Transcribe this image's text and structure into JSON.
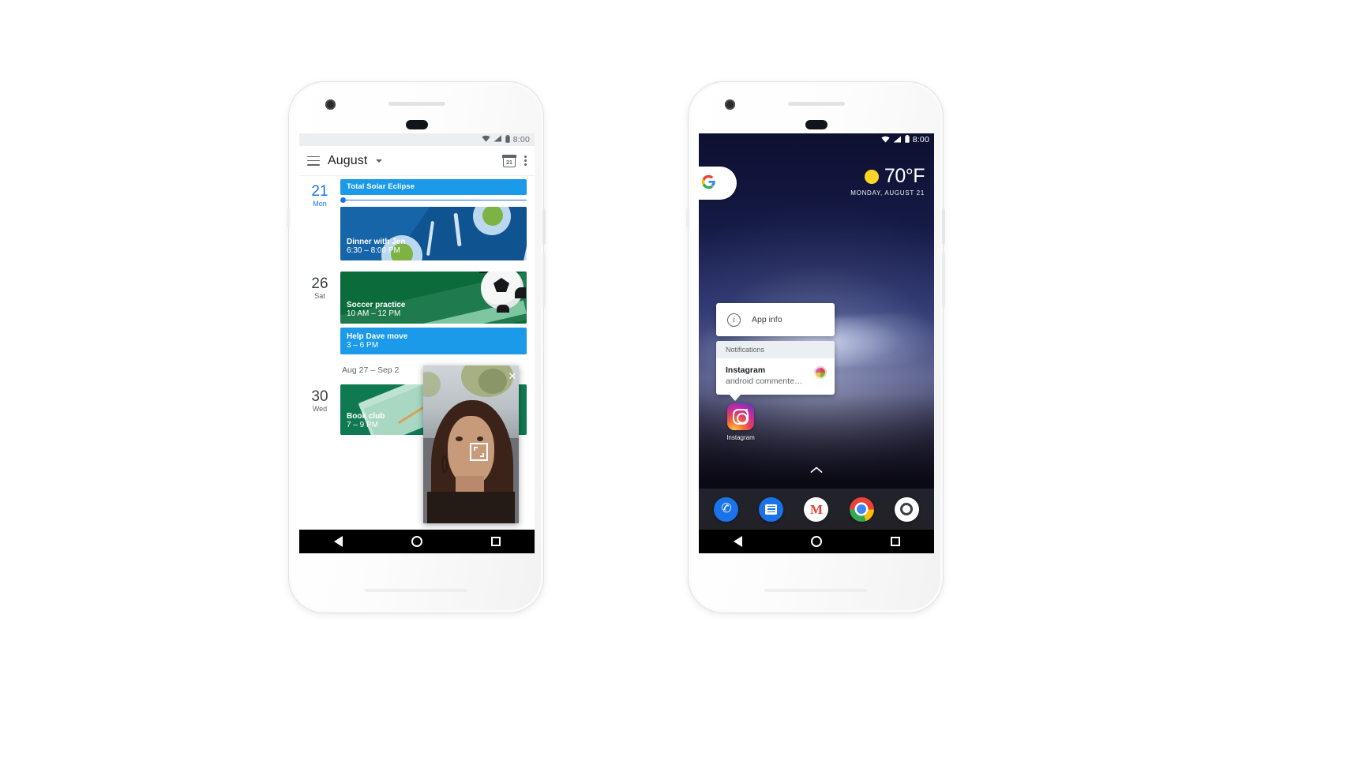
{
  "scene": {
    "background": "#ffffff",
    "accent_blue": "#1a73e8",
    "event_blue": "#1a9ae8",
    "event_green": "#0b6b3a"
  },
  "left_phone": {
    "label": "pixel-phone-calendar",
    "status_bar": {
      "time": "8:00",
      "icons": [
        "wifi-icon",
        "signal-icon",
        "battery-icon"
      ]
    },
    "app_bar": {
      "menu_icon": "hamburger-menu-icon",
      "title": "August",
      "dropdown_icon": "chevron-down-icon",
      "date_icon_label": "21",
      "overflow_icon": "kebab-menu-icon"
    },
    "schedule": [
      {
        "day_number": "21",
        "day_name": "Mon",
        "is_today": true,
        "events": [
          {
            "title": "Total Solar Eclipse",
            "time": "",
            "style": "blue-allday"
          },
          {
            "title": "Dinner with Jen",
            "time": "6:30 – 8:00 PM",
            "style": "image-dinner"
          }
        ]
      },
      {
        "day_number": "26",
        "day_name": "Sat",
        "is_today": false,
        "events": [
          {
            "title": "Soccer practice",
            "time": "10 AM – 12 PM",
            "style": "image-soccer"
          },
          {
            "title": "Help Dave move",
            "time": "3 – 6 PM",
            "style": "blue-small"
          }
        ]
      }
    ],
    "week_separator": "Aug 27 – Sep 2",
    "schedule_next": [
      {
        "day_number": "30",
        "day_name": "Wed",
        "is_today": false,
        "events": [
          {
            "title": "Book club",
            "time": "7 – 9 PM",
            "style": "image-book"
          }
        ]
      }
    ],
    "pip": {
      "name": "picture-in-picture-video",
      "close_icon": "close-icon",
      "expand_icon": "expand-fullscreen-icon"
    },
    "nav_bar": {
      "back": "back-icon",
      "home": "home-icon",
      "recents": "recents-icon"
    }
  },
  "right_phone": {
    "label": "pixel-phone-home-screen",
    "status_bar": {
      "time": "8:00",
      "icons": [
        "wifi-icon",
        "signal-icon",
        "battery-icon"
      ]
    },
    "search_widget": {
      "icon": "google-g-icon",
      "letter": "G"
    },
    "weather_widget": {
      "icon": "sun-icon",
      "temperature": "70°F",
      "date": "MONDAY, AUGUST 21"
    },
    "app_info_card": {
      "icon": "info-icon",
      "label": "App info"
    },
    "notification_popup": {
      "header": "Notifications",
      "app_name": "Instagram",
      "message": "android commente…",
      "thumbnail": "photo-thumbnail"
    },
    "home_app": {
      "icon": "instagram-icon",
      "label": "Instagram"
    },
    "app_drawer_handle": "chevron-up-icon",
    "dock": [
      {
        "name": "phone-app",
        "icon": "phone-icon"
      },
      {
        "name": "messages-app",
        "icon": "messages-icon"
      },
      {
        "name": "gmail-app",
        "icon": "gmail-icon"
      },
      {
        "name": "chrome-app",
        "icon": "chrome-icon"
      },
      {
        "name": "camera-app",
        "icon": "camera-icon"
      }
    ],
    "nav_bar": {
      "back": "back-icon",
      "home": "home-icon",
      "recents": "recents-icon"
    }
  }
}
